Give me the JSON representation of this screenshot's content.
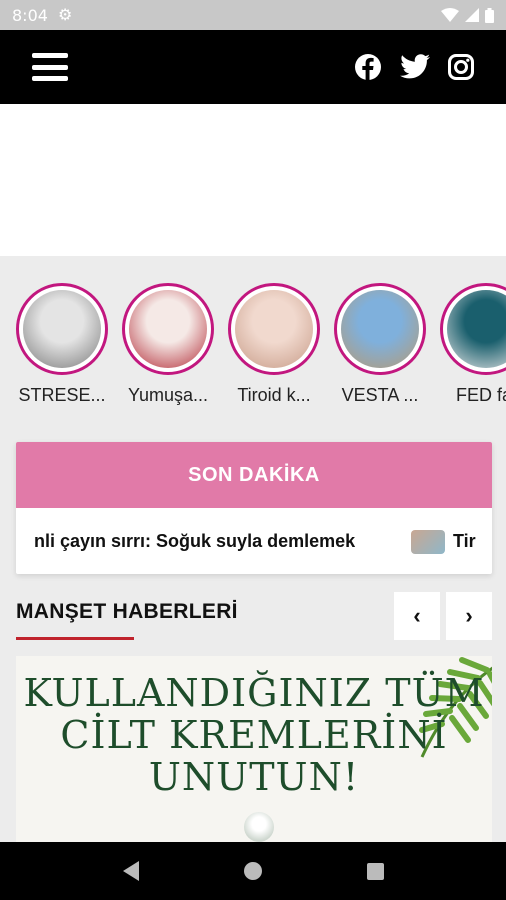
{
  "status_bar": {
    "time": "8:04"
  },
  "stories": [
    {
      "label": "STRESE...",
      "thumb_colors": [
        "#e4e4e4",
        "#7a7a7a"
      ]
    },
    {
      "label": "Yumuşa...",
      "thumb_colors": [
        "#f5e9e6",
        "#b22b36"
      ]
    },
    {
      "label": "Tiroid k...",
      "thumb_colors": [
        "#f1d9ce",
        "#c79b87"
      ]
    },
    {
      "label": "VESTA ...",
      "thumb_colors": [
        "#7fb0dc",
        "#b59a74"
      ]
    },
    {
      "label": "FED fai",
      "thumb_colors": [
        "#1a5f6d",
        "#e7e7e7"
      ]
    }
  ],
  "breaking_news": {
    "title": "SON DAKİKA",
    "ticker_1": "nli çayın sırrı: Soğuk suyla demlemek",
    "ticker_2": "Tir"
  },
  "section": {
    "title": "MANŞET HABERLERİ",
    "prev": "‹",
    "next": "›"
  },
  "headline": {
    "line_1": "KULLANDIĞINIZ TÜM",
    "line_2": "CİLT KREMLERİNİ",
    "line_3": "UNUTUN!"
  },
  "colors": {
    "accent_pink": "#e17aa8",
    "story_ring": "#c2177f",
    "section_underline": "#c0232c",
    "headline_green": "#1e4d2b"
  },
  "icons": [
    "settings-gear-icon",
    "wifi-icon",
    "signal-icon",
    "battery-icon",
    "hamburger-menu-icon",
    "facebook-icon",
    "twitter-icon",
    "instagram-icon",
    "nav-back-icon",
    "nav-home-icon",
    "nav-recents-icon"
  ]
}
